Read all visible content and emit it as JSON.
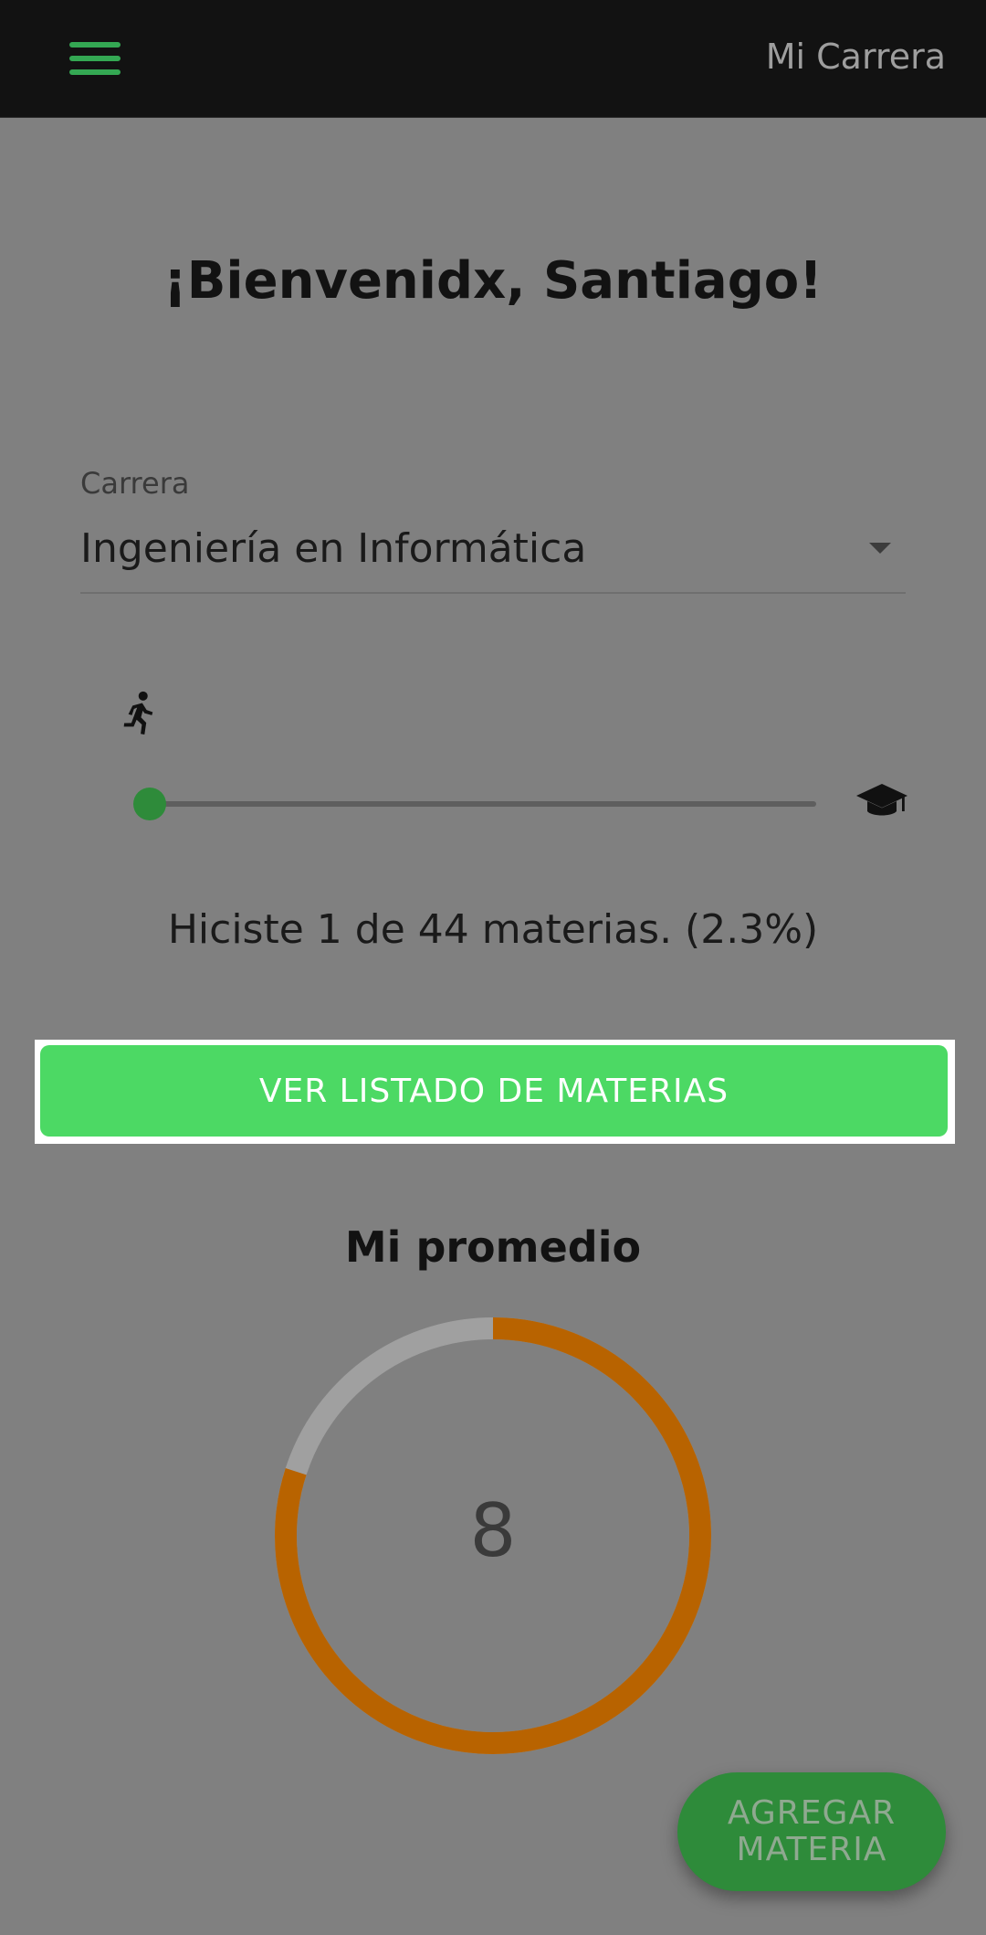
{
  "colors": {
    "accent": "#4cd964",
    "accent_dark": "#2e8b3a",
    "menu_icon": "#34a853",
    "gauge_fill": "#b86300",
    "gauge_track": "#a0a0a0",
    "fab": "#2e8b3a"
  },
  "appbar": {
    "menu_icon": "hamburger-menu-icon",
    "title": "Mi Carrera"
  },
  "welcome": "¡Bienvenidx, Santiago!",
  "carrera": {
    "label": "Carrera",
    "value": "Ingeniería en Informática",
    "dropdown_icon": "caret-down-icon"
  },
  "progress": {
    "start_icon": "running-person-icon",
    "end_icon": "graduation-cap-icon",
    "fraction": 0.023,
    "text": "Hiciste 1 de 44 materias. (2.3%)"
  },
  "buttons": {
    "ver_listado": "VER LISTADO DE MATERIAS"
  },
  "promedio": {
    "title": "Mi promedio",
    "value": "8",
    "fraction": 0.8
  },
  "fab": {
    "line1": "AGREGAR",
    "line2": "MATERIA"
  }
}
